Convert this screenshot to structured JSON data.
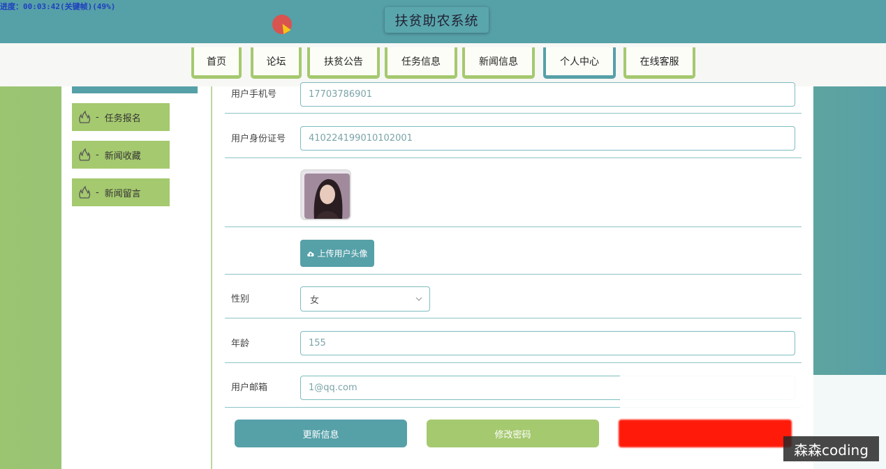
{
  "overlay": {
    "progress_text": "进度：00:03:42(关键帧)(49%)",
    "watermark": "森森coding"
  },
  "header": {
    "title": "扶贫助农系统"
  },
  "nav": {
    "items": [
      {
        "label": "首页"
      },
      {
        "label": "论坛"
      },
      {
        "label": "扶贫公告"
      },
      {
        "label": "任务信息"
      },
      {
        "label": "新闻信息"
      },
      {
        "label": "个人中心",
        "active": true
      },
      {
        "label": "在线客服"
      }
    ]
  },
  "sidebar": {
    "items": [
      {
        "label": "任务报名",
        "icon": "flame-icon"
      },
      {
        "label": "新闻收藏",
        "icon": "flame-icon"
      },
      {
        "label": "新闻留言",
        "icon": "flame-icon"
      }
    ],
    "separator": "-"
  },
  "form": {
    "phone_label": "用户手机号",
    "phone_value": "17703786901",
    "idcard_label": "用户身份证号",
    "idcard_value": "410224199010102001",
    "upload_label": "上传用户头像",
    "gender_label": "性别",
    "gender_value": "女",
    "age_label": "年龄",
    "age_value": "155",
    "email_label": "用户邮箱",
    "email_value": "1@qq.com"
  },
  "actions": {
    "update_label": "更新信息",
    "password_label": "修改密码"
  },
  "colors": {
    "primary": "#56a0a8",
    "accent": "#a5c96f",
    "danger": "#ff1a0a"
  }
}
